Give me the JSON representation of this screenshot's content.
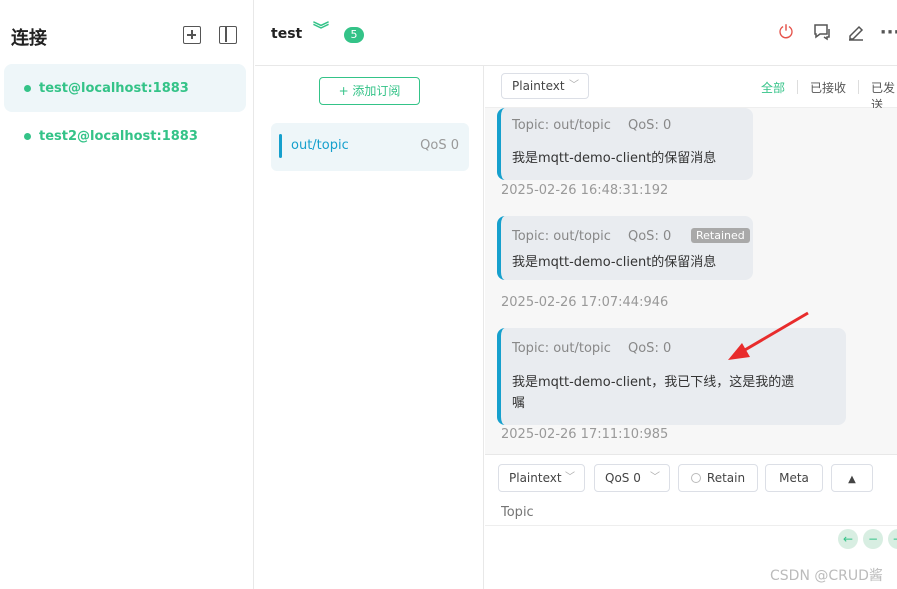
{
  "sidebar": {
    "title": "连接",
    "connections": [
      {
        "name": "test@localhost:1883"
      },
      {
        "name": "test2@localhost:1883"
      }
    ]
  },
  "header": {
    "connection_name": "test",
    "badge_count": "5"
  },
  "subscriptions": {
    "add_label": "+ 添加订阅",
    "items": [
      {
        "topic": "out/topic",
        "qos": "QoS 0"
      }
    ]
  },
  "message_toolbar": {
    "format": "Plaintext",
    "filters": [
      "全部",
      "已接收",
      "已发送"
    ]
  },
  "messages": [
    {
      "topic": "Topic: out/topic",
      "qos": "QoS: 0",
      "payload": "我是mqtt-demo-client的保留消息",
      "time": "2025-02-26 16:48:31:192",
      "retained": ""
    },
    {
      "topic": "Topic: out/topic",
      "qos": "QoS: 0",
      "payload": "我是mqtt-demo-client的保留消息",
      "time": "2025-02-26 17:07:44:946",
      "retained": "Retained"
    },
    {
      "topic": "Topic: out/topic",
      "qos": "QoS: 0",
      "payload_line1": "我是mqtt-demo-client，我已下线，这是我的遗",
      "payload_line2": "嘱",
      "time": "2025-02-26 17:11:10:985"
    }
  ],
  "publish": {
    "format": "Plaintext",
    "qos": "QoS 0",
    "retain_label": "Retain",
    "meta_label": "Meta",
    "topic_placeholder": "Topic"
  },
  "watermark": "CSDN @CRUD酱",
  "colors": {
    "accent": "#34c388",
    "topic_blue": "#16a0cd",
    "power_red": "#e5534b"
  }
}
